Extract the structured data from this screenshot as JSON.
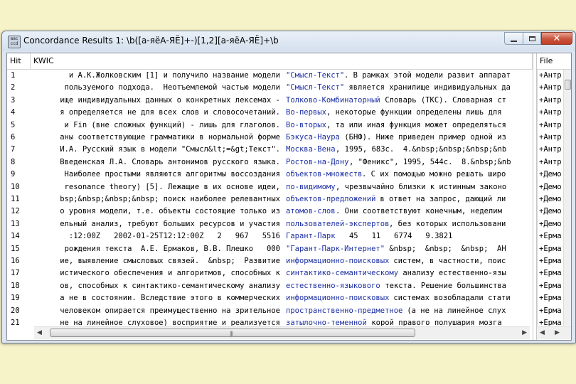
{
  "window": {
    "title": "Concordance Results 1: \\b([а-яёА-ЯЁ]+-)[1,2][а-яёА-ЯЁ]+\\b",
    "icon_text": [
      "aac",
      "ccd",
      "cccc"
    ]
  },
  "columns": {
    "hit": "Hit",
    "kwic": "KWIC",
    "file": "File"
  },
  "rows": [
    {
      "hit": "1",
      "left": " и А.К.Жолковским [1] и получило название модели ",
      "match": "\"Смысл-Текст\"",
      "right": ". В рамках этой модели развит аппарат",
      "file": "+Антр"
    },
    {
      "hit": "2",
      "left": "пользуемого подхода.  Неотъемлемой частью модели ",
      "match": "\"Смысл-Текст\"",
      "right": " является хранилище индивидуальных да",
      "file": "+Антр"
    },
    {
      "hit": "3",
      "left": "ище индивидуальных данных о конкретных лексемах - ",
      "match": "Толково-Комбинаторный",
      "right": " Словарь (ТКС). Словарная ст",
      "file": "+Антр"
    },
    {
      "hit": "4",
      "left": "я определяется не для всех слов и словосочетаний. ",
      "match": "Во-первых",
      "right": ", некоторые функции определены лишь для",
      "file": "+Антр"
    },
    {
      "hit": "5",
      "left": " и Fin (вне сложных функций) - лишь для глаголов. ",
      "match": "Во-вторых",
      "right": ", та или иная функция может определяться",
      "file": "+Антр"
    },
    {
      "hit": "6",
      "left": "аны соответствующие грамматики в нормальной форме ",
      "match": "Бэкуса-Наура",
      "right": " (БНФ). Ниже приведен пример одной из",
      "file": "+Антр"
    },
    {
      "hit": "7",
      "left": "И.А. Русский язык в модели \"Смысл&lt;=&gt;Текст\". ",
      "match": "Москва-Вена",
      "right": ", 1995, 683с.  4.&nbsp;&nbsp;&nbsp;&nb",
      "file": "+Антр"
    },
    {
      "hit": "8",
      "left": "Введенская Л.А. Словарь антонимов русского языка. ",
      "match": "Ростов-на-Дону",
      "right": ", \"Феникс\", 1995, 544с.  8.&nbsp;&nb",
      "file": "+Антр"
    },
    {
      "hit": "9",
      "left": " Наиболее простыми являются алгоритмы воссоздания ",
      "match": "объектов-множеств",
      "right": ". С их помощью можно решать широ",
      "file": "+Демо"
    },
    {
      "hit": "10",
      "left": " resonance theory) [5]. Лежащие в их основе идеи, ",
      "match": "по-видимому",
      "right": ", чрезвычайно близки к истинным законо",
      "file": "+Демо"
    },
    {
      "hit": "11",
      "left": "bsp;&nbsp;&nbsp;&nbsp; поиск наиболее релевантных ",
      "match": "объектов-предложений",
      "right": " в ответ на запрос, дающий ли",
      "file": "+Демо"
    },
    {
      "hit": "12",
      "left": "о уровня модели, т.е. объекты состоящие только из ",
      "match": "атомов-слов",
      "right": ". Они соответствуют конечным, неделим",
      "file": "+Демо"
    },
    {
      "hit": "13",
      "left": "ельный анализ, требуют больших ресурсов и участия ",
      "match": "пользователей-экспертов",
      "right": ", без которых использовани",
      "file": "+Демо"
    },
    {
      "hit": "14",
      "left": ":12:00Z   2002-01-25T12:12:00Z   2   967   5516   ",
      "match": "Гарант-Парк",
      "right": "   45   11   6774   9.3821",
      "file": "+Ерма"
    },
    {
      "hit": "15",
      "left": "рождения текста  А.Е. Ермаков, В.В. Плешко   000 ",
      "match": "\"Гарант-Парк-Интернет\"",
      "right": " &nbsp;  &nbsp;  &nbsp;  АН",
      "file": "+Ерма"
    },
    {
      "hit": "16",
      "left": "ие, выявление смысловых связей.  &nbsp;  Развитие ",
      "match": "информационно-поисковых",
      "right": " систем, в частности, поис",
      "file": "+Ерма"
    },
    {
      "hit": "17",
      "left": "истического обеспечения и алгоритмов, способных к ",
      "match": "синтактико-семантическому",
      "right": " анализу естественно-язы",
      "file": "+Ерма"
    },
    {
      "hit": "18",
      "left": "ов, способных к синтактико-семантическому анализу ",
      "match": "естественно-языкового",
      "right": " текста. Решение большинства",
      "file": "+Ерма"
    },
    {
      "hit": "19",
      "left": "а не в состоянии. Вследствие этого в коммерческих ",
      "match": "информационно-поисковых",
      "right": " системах возобладали стати",
      "file": "+Ерма"
    },
    {
      "hit": "20",
      "left": "человеком опирается преимущественно на зрительное ",
      "match": "пространственно-предметное",
      "right": " (а не на линейное слух",
      "file": "+Ерма"
    },
    {
      "hit": "21",
      "left": "не на линейное слуховое) восприятие и реализуется ",
      "match": "затылочно-теменной",
      "right": " корой правого полушария мозга",
      "file": "+Ерма"
    }
  ],
  "colors": {
    "match": "#1c2fa3",
    "background": "#f7f3c9",
    "close_button": "#c9533b"
  }
}
